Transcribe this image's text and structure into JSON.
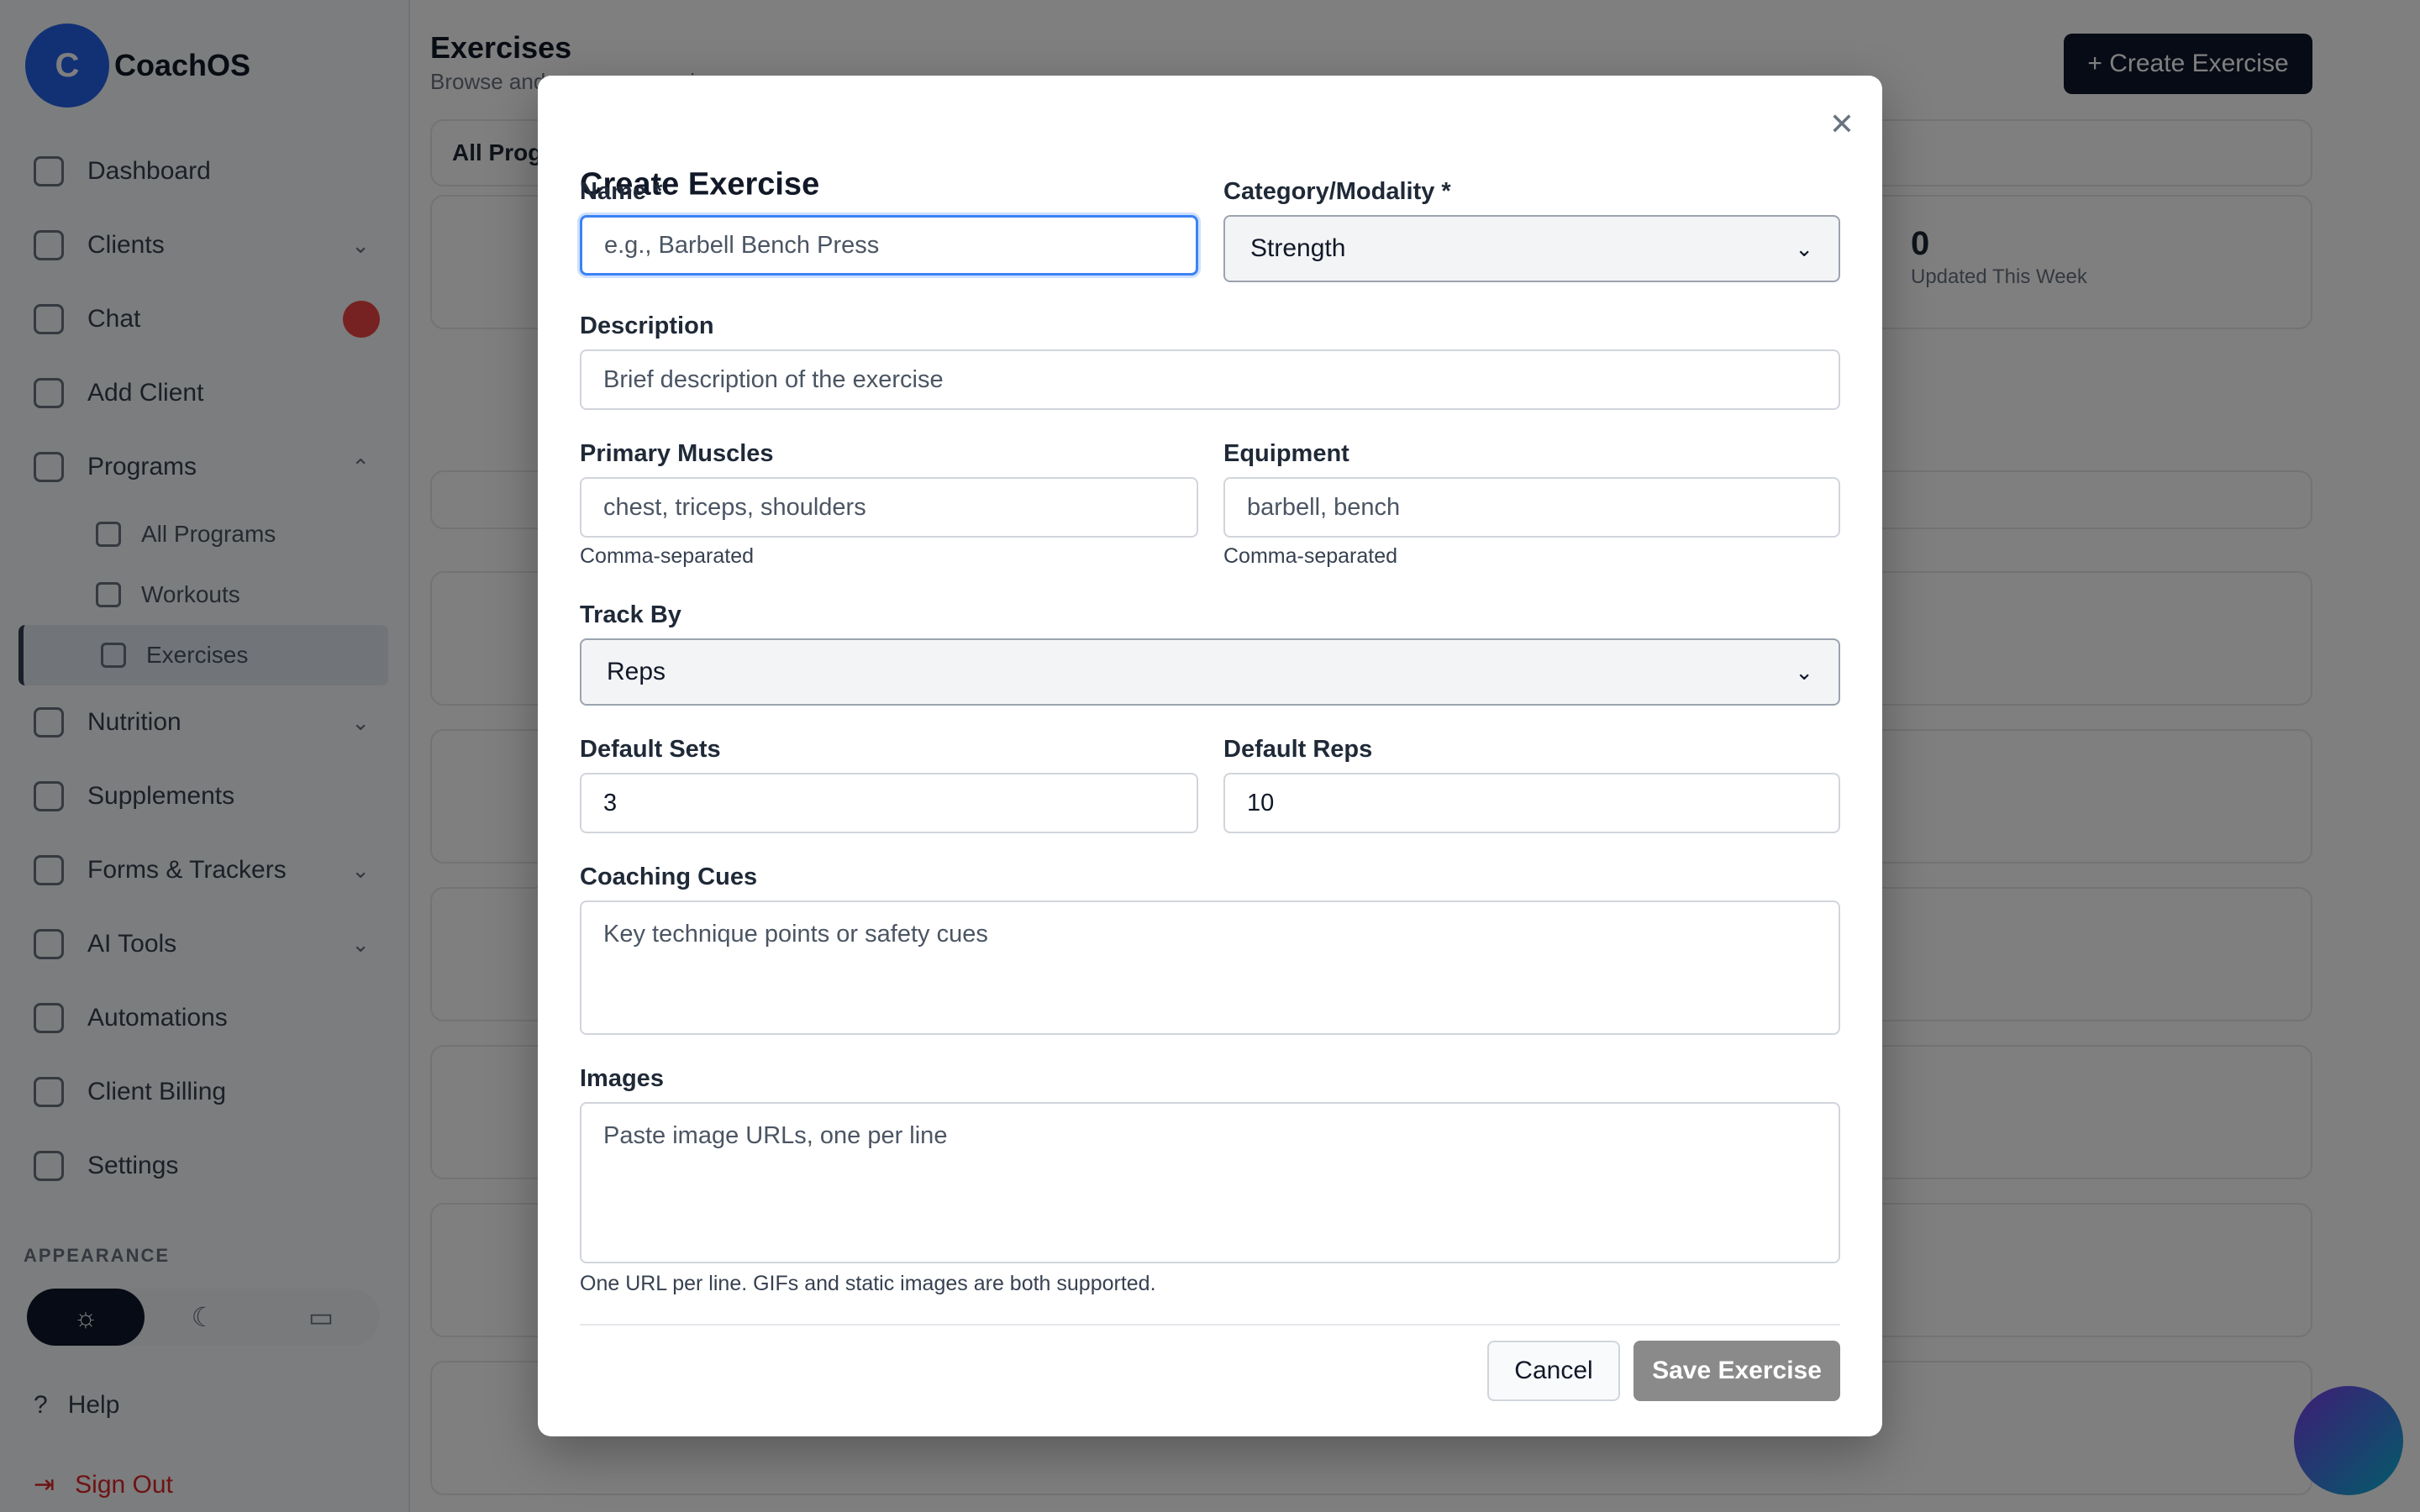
{
  "app": {
    "brand": "CoachOS",
    "brand_initial": "C",
    "nav": [
      {
        "label": "Dashboard"
      },
      {
        "label": "Clients"
      },
      {
        "label": "Chat"
      },
      {
        "label": "Add Client"
      },
      {
        "label": "Programs"
      }
    ],
    "programs_sub": [
      {
        "label": "All Programs"
      },
      {
        "label": "Workouts"
      },
      {
        "label": "Exercises"
      }
    ],
    "nav_rest": [
      {
        "label": "Nutrition"
      },
      {
        "label": "Supplements"
      },
      {
        "label": "Forms & Trackers"
      },
      {
        "label": "AI Tools"
      },
      {
        "label": "Automations"
      },
      {
        "label": "Client Billing"
      },
      {
        "label": "Settings"
      }
    ],
    "appearance_label": "APPEARANCE",
    "help": "Help",
    "sign_out": "Sign Out",
    "page_title": "Exercises",
    "page_sub": "Browse and manage exercises",
    "create_button": "+ Create Exercise",
    "tab_label": "All Programs",
    "stat_value": "0",
    "stat_label": "Updated This Week"
  },
  "modal": {
    "title": "Create Exercise",
    "close_symbol": "✕",
    "name": {
      "label": "Name *",
      "placeholder": "e.g., Barbell Bench Press",
      "value": ""
    },
    "category": {
      "label": "Category/Modality *",
      "selected": "Strength"
    },
    "description": {
      "label": "Description",
      "placeholder": "Brief description of the exercise",
      "value": ""
    },
    "primary_muscles": {
      "label": "Primary Muscles",
      "placeholder": "chest, triceps, shoulders",
      "hint": "Comma-separated"
    },
    "equipment": {
      "label": "Equipment",
      "placeholder": "barbell, bench",
      "hint": "Comma-separated"
    },
    "track_by": {
      "label": "Track By",
      "selected": "Reps"
    },
    "default_sets": {
      "label": "Default Sets",
      "value": "3"
    },
    "default_reps": {
      "label": "Default Reps",
      "value": "10"
    },
    "coaching_cues": {
      "label": "Coaching Cues",
      "placeholder": "Key technique points or safety cues"
    },
    "images": {
      "label": "Images",
      "placeholder": "Paste image URLs, one per line",
      "hint": "One URL per line. GIFs and static images are both supported."
    },
    "cancel_label": "Cancel",
    "save_label": "Save Exercise"
  }
}
